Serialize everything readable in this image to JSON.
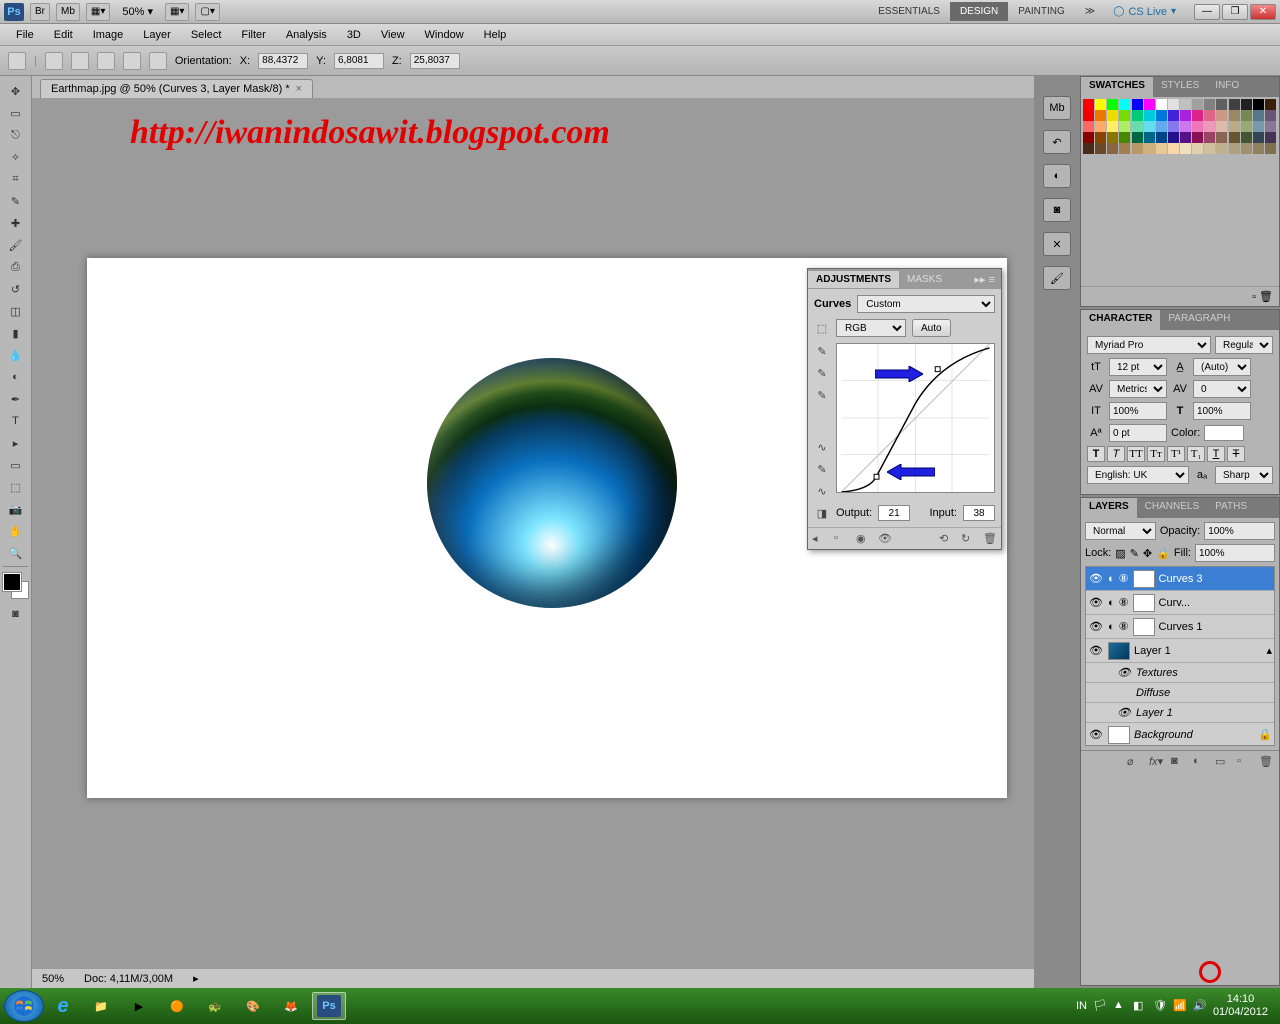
{
  "titlebar": {
    "app": "Ps",
    "bridge": "Br",
    "mb": "Mb",
    "zoom": "50%",
    "workspaces": {
      "essentials": "ESSENTIALS",
      "design": "DESIGN",
      "painting": "PAINTING"
    },
    "cslive": "CS Live"
  },
  "menu": {
    "file": "File",
    "edit": "Edit",
    "image": "Image",
    "layer": "Layer",
    "select": "Select",
    "filter": "Filter",
    "analysis": "Analysis",
    "threeD": "3D",
    "view": "View",
    "window": "Window",
    "help": "Help"
  },
  "options": {
    "orientation": "Orientation:",
    "x_lbl": "X:",
    "x": "88,4372",
    "y_lbl": "Y:",
    "y": "6,8081",
    "z_lbl": "Z:",
    "z": "25,8037"
  },
  "doc": {
    "tab": "Earthmap.jpg @ 50% (Curves 3, Layer Mask/8) *",
    "url": "http://iwanindosawit.blogspot.com",
    "zoom": "50%",
    "docsize": "Doc: 4,11M/3,00M"
  },
  "adjustments": {
    "tab1": "ADJUSTMENTS",
    "tab2": "MASKS",
    "title": "Curves",
    "preset": "Custom",
    "channel": "RGB",
    "auto": "Auto",
    "output_lbl": "Output:",
    "output": "21",
    "input_lbl": "Input:",
    "input": "38"
  },
  "swatches": {
    "tab1": "SWATCHES",
    "tab2": "STYLES",
    "tab3": "INFO"
  },
  "character": {
    "tab1": "CHARACTER",
    "tab2": "PARAGRAPH",
    "font": "Myriad Pro",
    "style": "Regular",
    "size": "12 pt",
    "leading": "(Auto)",
    "kerning": "Metrics",
    "tracking": "0",
    "vscale": "100%",
    "hscale": "100%",
    "baseline": "0 pt",
    "color_lbl": "Color:",
    "lang": "English: UK",
    "aa": "Sharp"
  },
  "layers": {
    "tab1": "LAYERS",
    "tab2": "CHANNELS",
    "tab3": "PATHS",
    "blend": "Normal",
    "opacity_lbl": "Opacity:",
    "opacity": "100%",
    "lock_lbl": "Lock:",
    "fill_lbl": "Fill:",
    "fill": "100%",
    "items": [
      "Curves 3",
      "Curv...",
      "Curves 1",
      "Layer 1",
      "Textures",
      "Diffuse",
      "Layer 1",
      "Background"
    ]
  },
  "taskbar": {
    "lang": "IN",
    "time": "14:10",
    "date": "01/04/2012"
  },
  "swatch_colors": [
    "#ff0000",
    "#ffff00",
    "#00ff00",
    "#00ffff",
    "#0000ff",
    "#ff00ff",
    "#ffffff",
    "#e0e0e0",
    "#c0c0c0",
    "#a0a0a0",
    "#808080",
    "#606060",
    "#404040",
    "#202020",
    "#000000",
    "#3a1f0a",
    "#ee0000",
    "#ee7700",
    "#eedd00",
    "#77dd00",
    "#00cc77",
    "#00ccdd",
    "#0077dd",
    "#4422dd",
    "#aa22dd",
    "#dd2288",
    "#dd6688",
    "#cc9988",
    "#998866",
    "#778855",
    "#557788",
    "#665577",
    "#ff6666",
    "#ffaa66",
    "#ffee66",
    "#aaee66",
    "#66ddaa",
    "#66ddee",
    "#66aaee",
    "#8877ee",
    "#cc77ee",
    "#ee77bb",
    "#ee99bb",
    "#ddbbaa",
    "#bbaa88",
    "#99aa77",
    "#7799aa",
    "#887799",
    "#880000",
    "#884400",
    "#887700",
    "#448800",
    "#006644",
    "#006688",
    "#004488",
    "#221188",
    "#551188",
    "#881155",
    "#994466",
    "#886655",
    "#665533",
    "#445533",
    "#334455",
    "#443355",
    "#4a2a1a",
    "#6a4a2a",
    "#886644",
    "#a08050",
    "#b89868",
    "#d0b080",
    "#e8c898",
    "#f8d8a8",
    "#f0e0c0",
    "#e0d0b0",
    "#d0c0a0",
    "#c0b090",
    "#b0a080",
    "#a09070",
    "#908060",
    "#807050"
  ]
}
